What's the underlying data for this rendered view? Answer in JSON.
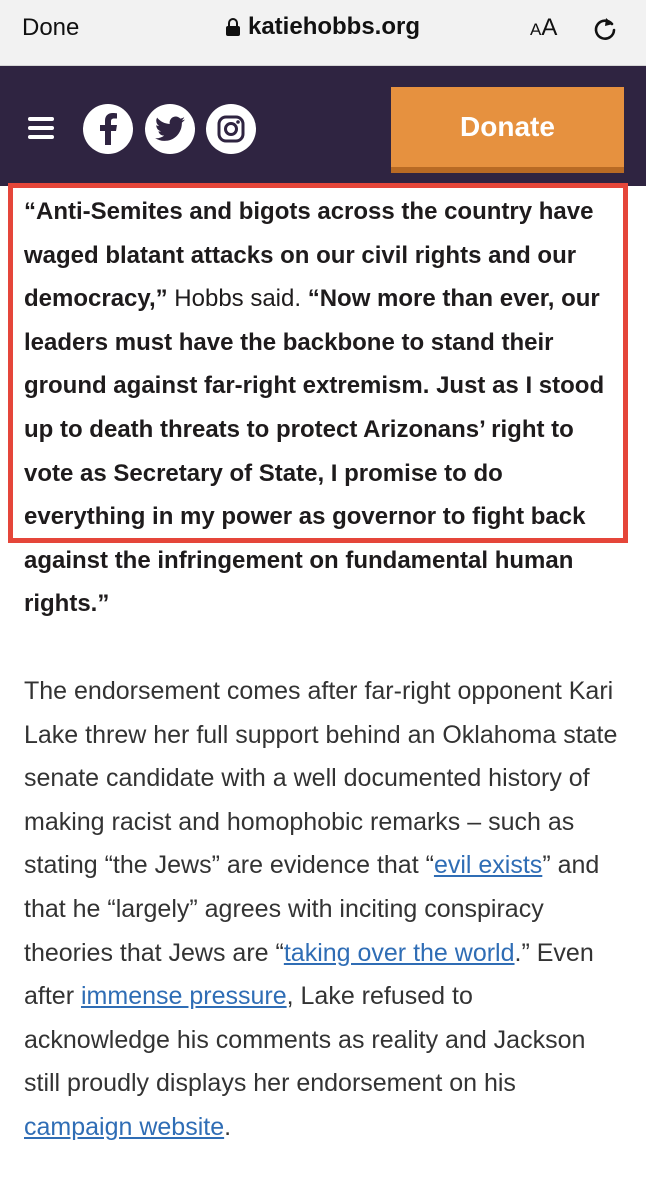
{
  "browser": {
    "done_label": "Done",
    "url": "katiehobbs.org",
    "text_size_label_small": "A",
    "text_size_label_large": "A"
  },
  "header": {
    "donate_label": "Donate",
    "colors": {
      "background": "#2f2441",
      "donate": "#e6913f"
    }
  },
  "article": {
    "quote_part1": "“Anti-Semites and bigots across the country have waged blatant attacks on our civil rights and our democracy,”",
    "said": " Hobbs said. ",
    "quote_part2": "“Now more than ever, our leaders must have the backbone to stand their ground against far-right extremism. Just as I stood up to death threats to protect Arizonans’ right to vote as Secretary of State, I promise to do everything in my power as governor to fight back against the infringement on fundamental human rights.”",
    "para_text1": "The endorsement comes after far-right opponent Kari Lake threw her full support behind an Oklahoma state senate candidate with a well documented history of making racist and homophobic remarks – such as stating  “the Jews” are evidence that “",
    "link1": "evil exists",
    "para_text2": "” and that he “largely” agrees with inciting conspiracy theories that Jews are “",
    "link2": "taking over the world",
    "para_text3": ".” Even after ",
    "link3": "immense pressure",
    "para_text4": ", Lake refused to acknowledge his comments as reality and Jackson still proudly displays her endorsement on his ",
    "link4": "campaign website",
    "para_text5": "."
  }
}
